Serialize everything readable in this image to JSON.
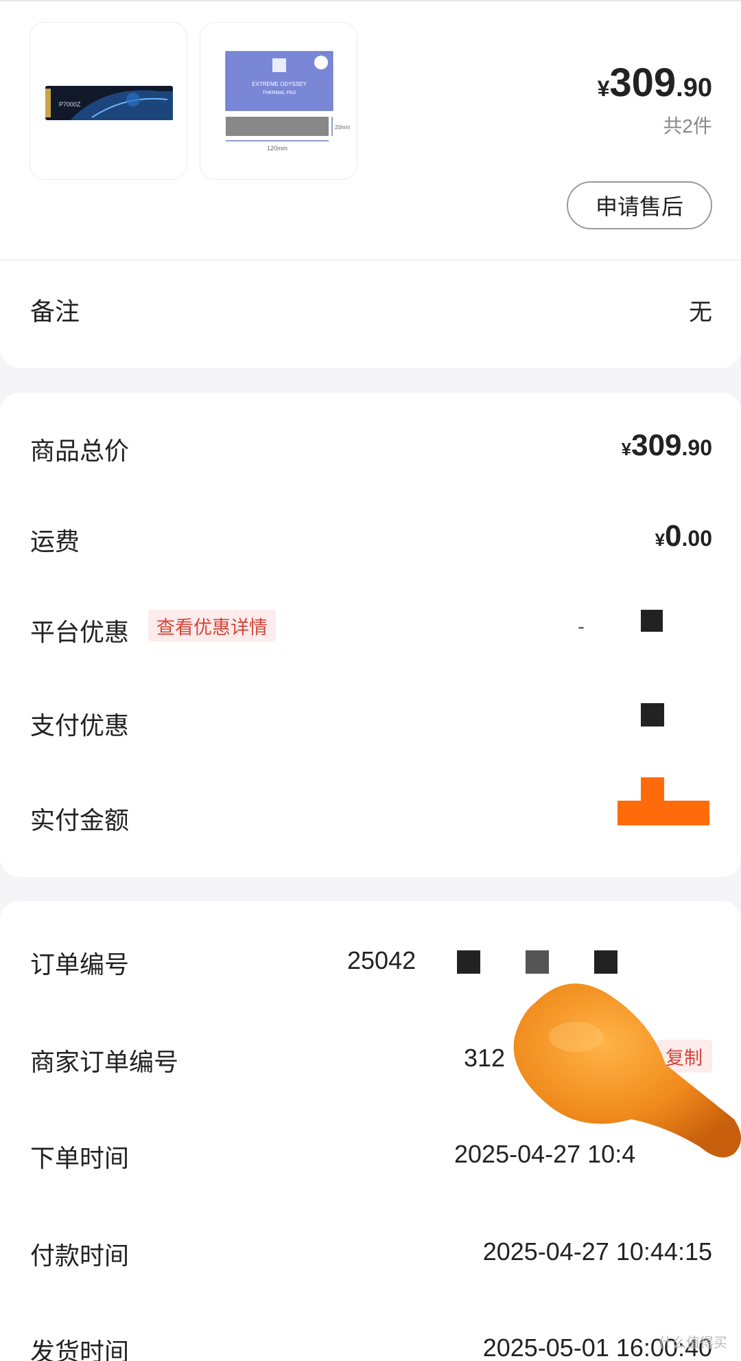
{
  "product_section": {
    "price_currency": "¥",
    "price_integer": "309",
    "price_decimal": ".90",
    "count_text": "共2件",
    "after_sale_button": "申请售后",
    "items": [
      {
        "label": "P7000Z"
      },
      {
        "label": "EXTREME ODYSSEY",
        "sub": "THERMAL PAD",
        "width_label": "120mm",
        "height_label": "20mm"
      }
    ]
  },
  "remark": {
    "label": "备注",
    "value": "无"
  },
  "payment": {
    "goods_total": {
      "label": "商品总价",
      "currency": "¥",
      "integer": "309",
      "decimal": ".90"
    },
    "shipping": {
      "label": "运费",
      "currency": "¥",
      "integer": "0",
      "decimal": ".00"
    },
    "platform_discount": {
      "label": "平台优惠",
      "tag": "查看优惠详情",
      "value_prefix": "-"
    },
    "payment_discount": {
      "label": "支付优惠"
    },
    "paid_amount": {
      "label": "实付金额"
    }
  },
  "order_info": {
    "order_no": {
      "label": "订单编号",
      "value": "25042"
    },
    "merchant_order_no": {
      "label": "商家订单编号",
      "value": "312",
      "copy": "复制"
    },
    "order_time": {
      "label": "下单时间",
      "value": "2025-04-27 10:4"
    },
    "pay_time": {
      "label": "付款时间",
      "value": "2025-04-27 10:44:15"
    },
    "ship_time": {
      "label": "发货时间",
      "value": "2025-05-01 16:00:40"
    }
  },
  "watermark": "什么值得买",
  "colors": {
    "accent_red": "#d4453a",
    "tag_bg": "#fdeceb",
    "orange": "#ff6a0a"
  }
}
